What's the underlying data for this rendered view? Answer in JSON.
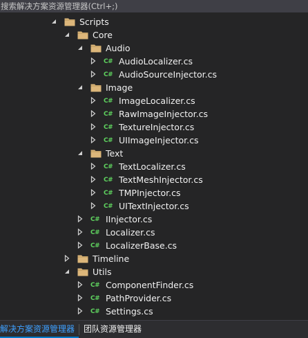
{
  "search": {
    "placeholder": "搜索解决方案资源管理器(Ctrl+;)"
  },
  "tree": [
    {
      "label": "Scripts",
      "type": "folder",
      "depth": 0,
      "expanded": true
    },
    {
      "label": "Core",
      "type": "folder",
      "depth": 1,
      "expanded": true
    },
    {
      "label": "Audio",
      "type": "folder",
      "depth": 2,
      "expanded": true
    },
    {
      "label": "AudioLocalizer.cs",
      "type": "cs",
      "depth": 3,
      "expanded": false
    },
    {
      "label": "AudioSourceInjector.cs",
      "type": "cs",
      "depth": 3,
      "expanded": false
    },
    {
      "label": "Image",
      "type": "folder",
      "depth": 2,
      "expanded": true
    },
    {
      "label": "ImageLocalizer.cs",
      "type": "cs",
      "depth": 3,
      "expanded": false
    },
    {
      "label": "RawImageInjector.cs",
      "type": "cs",
      "depth": 3,
      "expanded": false
    },
    {
      "label": "TextureInjector.cs",
      "type": "cs",
      "depth": 3,
      "expanded": false
    },
    {
      "label": "UIImageInjector.cs",
      "type": "cs",
      "depth": 3,
      "expanded": false
    },
    {
      "label": "Text",
      "type": "folder",
      "depth": 2,
      "expanded": true
    },
    {
      "label": "TextLocalizer.cs",
      "type": "cs",
      "depth": 3,
      "expanded": false
    },
    {
      "label": "TextMeshInjector.cs",
      "type": "cs",
      "depth": 3,
      "expanded": false
    },
    {
      "label": "TMPInjector.cs",
      "type": "cs",
      "depth": 3,
      "expanded": false
    },
    {
      "label": "UITextInjector.cs",
      "type": "cs",
      "depth": 3,
      "expanded": false
    },
    {
      "label": "IInjector.cs",
      "type": "cs",
      "depth": 2,
      "expanded": false
    },
    {
      "label": "Localizer.cs",
      "type": "cs",
      "depth": 2,
      "expanded": false
    },
    {
      "label": "LocalizerBase.cs",
      "type": "cs",
      "depth": 2,
      "expanded": false
    },
    {
      "label": "Timeline",
      "type": "folder",
      "depth": 1,
      "expanded": false
    },
    {
      "label": "Utils",
      "type": "folder",
      "depth": 1,
      "expanded": true
    },
    {
      "label": "ComponentFinder.cs",
      "type": "cs",
      "depth": 2,
      "expanded": false
    },
    {
      "label": "PathProvider.cs",
      "type": "cs",
      "depth": 2,
      "expanded": false
    },
    {
      "label": "Settings.cs",
      "type": "cs",
      "depth": 2,
      "expanded": false
    }
  ],
  "cs_badge": "C#",
  "tabs": [
    {
      "label": "解决方案资源管理器",
      "active": true
    },
    {
      "label": "团队资源管理器",
      "active": false
    }
  ],
  "colors": {
    "background": "#252526",
    "folder": "#dcb67a",
    "cs_badge": "#5fd35f",
    "active_tab": "#3ea0ff"
  }
}
